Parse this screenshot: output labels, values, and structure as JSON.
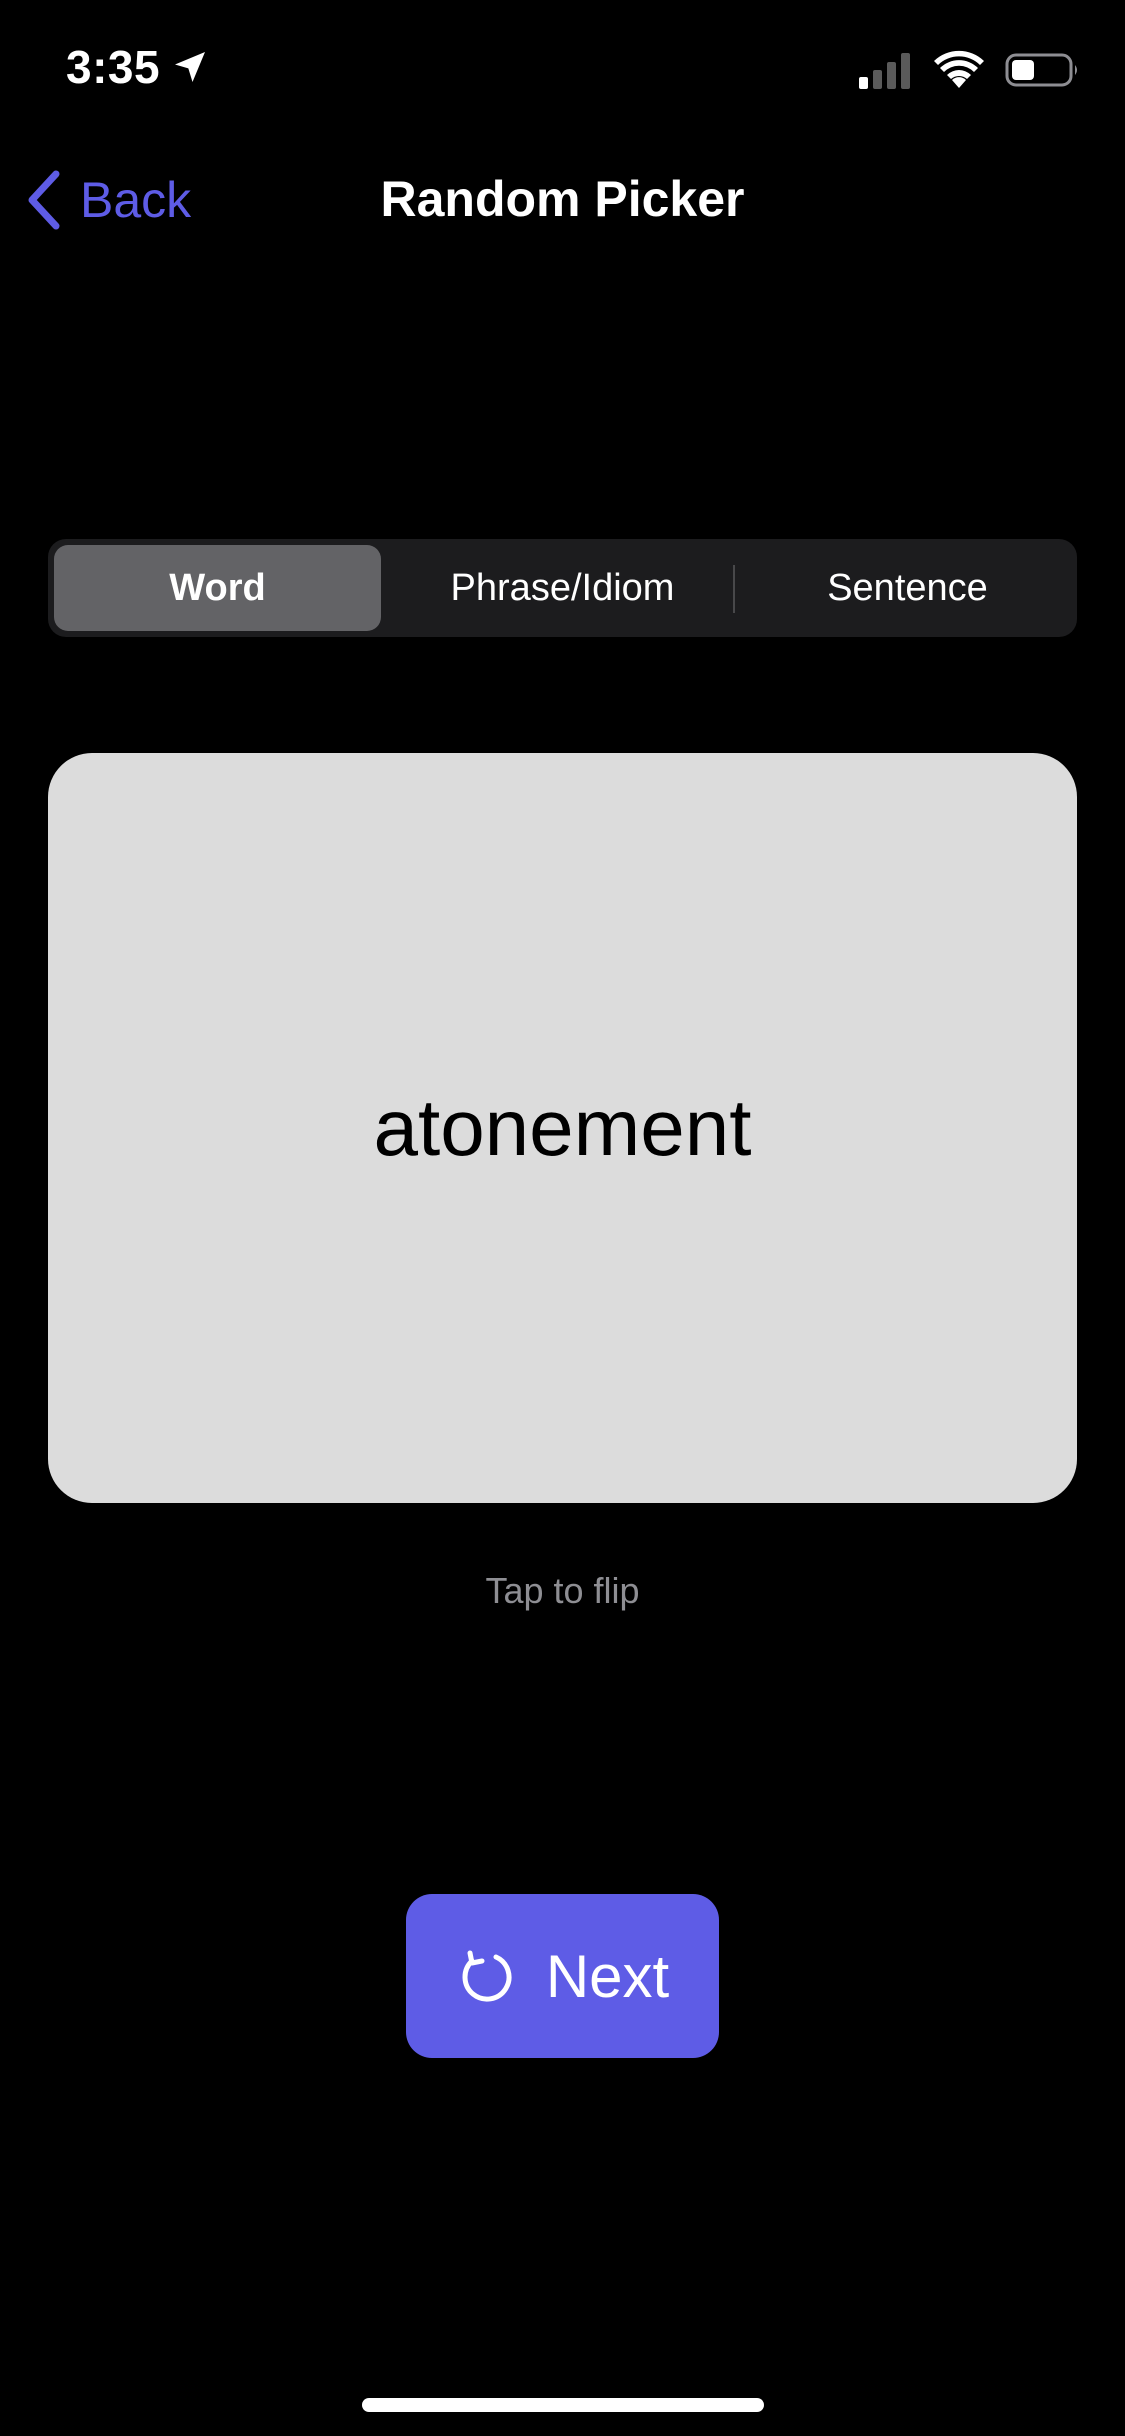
{
  "status_bar": {
    "time": "3:35",
    "icons": [
      "location-arrow-icon",
      "cellular-signal-icon",
      "wifi-icon",
      "battery-icon"
    ]
  },
  "nav": {
    "back_label": "Back",
    "title": "Random Picker",
    "back_icon": "chevron-left-icon"
  },
  "segments": {
    "items": [
      {
        "label": "Word",
        "selected": true
      },
      {
        "label": "Phrase/Idiom",
        "selected": false
      },
      {
        "label": "Sentence",
        "selected": false
      }
    ]
  },
  "card": {
    "text": "atonement"
  },
  "hint": "Tap to flip",
  "next_button": {
    "label": "Next",
    "icon": "refresh-icon"
  },
  "colors": {
    "accent": "#5e5ce6",
    "background": "#000000",
    "card": "#dcdcdc",
    "segment_bg": "#1c1c1e",
    "segment_selected": "#636366",
    "hint": "#8e8e93"
  }
}
